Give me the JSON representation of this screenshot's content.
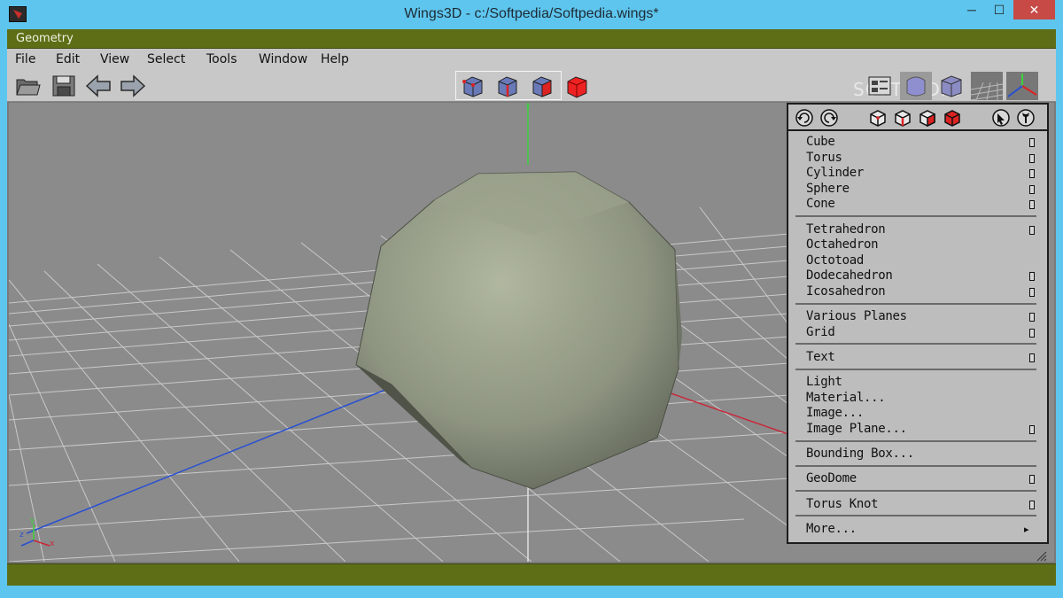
{
  "window": {
    "title": "Wings3D - c:/Softpedia/Softpedia.wings*",
    "minimize": "─",
    "maximize": "☐",
    "close": "✕"
  },
  "geometry_bar": {
    "label": "Geometry"
  },
  "menu": {
    "items": [
      "File",
      "Edit",
      "View",
      "Select",
      "Tools",
      "Window",
      "Help"
    ]
  },
  "toolbar": {
    "left_icons": [
      "open-folder-icon",
      "save-icon",
      "undo-arrow-icon",
      "redo-arrow-icon"
    ],
    "selection_modes": [
      "vertex-select-icon",
      "edge-select-icon",
      "face-select-icon",
      "body-select-icon"
    ],
    "right_icons": [
      "material-view-icon",
      "smooth-shading-icon",
      "wireframe-icon",
      "ground-plane-icon",
      "axes-icon"
    ],
    "watermark": "SOFTPEDIA"
  },
  "viewport": {
    "axis_y_label": "Y",
    "mini_axes": {
      "x": "x",
      "y": "y",
      "z": "z"
    },
    "colors": {
      "x_axis": "#c8283a",
      "y_axis": "#3cd23c",
      "z_axis": "#2850d2",
      "grid": "#c9c9c9",
      "model": "#8d9480"
    }
  },
  "panel": {
    "sections": [
      [
        {
          "label": "Cube",
          "opt": true
        },
        {
          "label": "Torus",
          "opt": true
        },
        {
          "label": "Cylinder",
          "opt": true
        },
        {
          "label": "Sphere",
          "opt": true
        },
        {
          "label": "Cone",
          "opt": true
        }
      ],
      [
        {
          "label": "Tetrahedron",
          "opt": true
        },
        {
          "label": "Octahedron",
          "opt": false
        },
        {
          "label": "Octotoad",
          "opt": false
        },
        {
          "label": "Dodecahedron",
          "opt": true
        },
        {
          "label": "Icosahedron",
          "opt": true
        }
      ],
      [
        {
          "label": "Various Planes",
          "opt": true
        },
        {
          "label": "Grid",
          "opt": true
        }
      ],
      [
        {
          "label": "Text",
          "opt": true
        }
      ],
      [
        {
          "label": "Light",
          "opt": false
        },
        {
          "label": "Material...",
          "opt": false
        },
        {
          "label": "Image...",
          "opt": false
        },
        {
          "label": "Image Plane...",
          "opt": true
        }
      ],
      [
        {
          "label": "Bounding Box...",
          "opt": false
        }
      ],
      [
        {
          "label": "GeoDome",
          "opt": true
        }
      ],
      [
        {
          "label": "Torus Knot",
          "opt": true
        }
      ],
      [
        {
          "label": "More...",
          "opt": false,
          "submenu": true
        }
      ]
    ]
  }
}
